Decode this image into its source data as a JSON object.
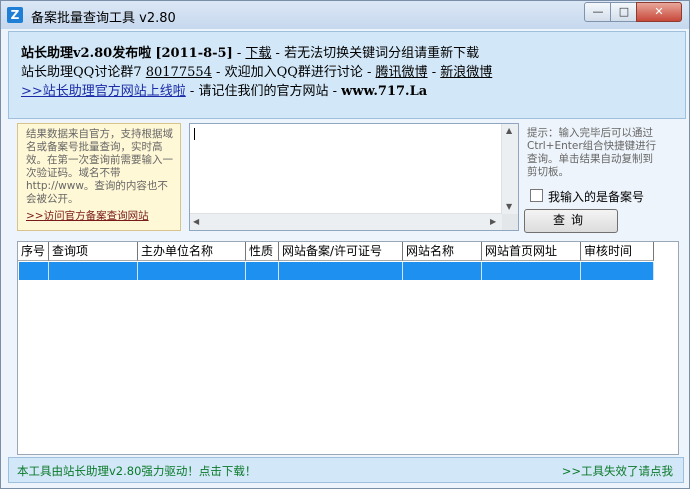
{
  "window": {
    "title": "备案批量查询工具 v2.80",
    "app_icon": "Z"
  },
  "banner": {
    "line1": {
      "headline": "站长助理v2.80发布啦",
      "date": "[2011-8-5]",
      "sep1": " - ",
      "download": "下载",
      "sep2": " - ",
      "tip": "若无法切换关键词分组请重新下载"
    },
    "line2": {
      "qq_prefix": "站长助理QQ讨论群7",
      "qq_number": "80177554",
      "welcome": " - 欢迎加入QQ群进行讨论 - ",
      "tencent": "腾讯微博",
      "dash": " - ",
      "sina": "新浪微博"
    },
    "line3": {
      "site_link": ">>站长助理官方网站上线啦",
      "remember": " - 请记住我们的官方网站 - ",
      "url": "www.717.La"
    }
  },
  "notice": {
    "text": "结果数据来自官方，支持根据域名或备案号批量查询，实时高效。在第一次查询前需要输入一次验证码。域名不带http://www。查询的内容也不会被公开。",
    "link": ">>访问官方备案查询网站"
  },
  "input": {
    "value": ""
  },
  "hint": "提示：输入完毕后可以通过Ctrl+Enter组合快捷键进行查询。单击结果自动复制到剪切板。",
  "checkbox_label": "我输入的是备案号",
  "query_button": "查询",
  "table": {
    "columns": [
      "序号",
      "查询项",
      "主办单位名称",
      "性质",
      "网站备案/许可证号",
      "网站名称",
      "网站首页网址",
      "审核时间"
    ]
  },
  "status": {
    "left": "本工具由站长助理v2.80强力驱动！点击下载！",
    "right": ">>工具失效了请点我"
  }
}
